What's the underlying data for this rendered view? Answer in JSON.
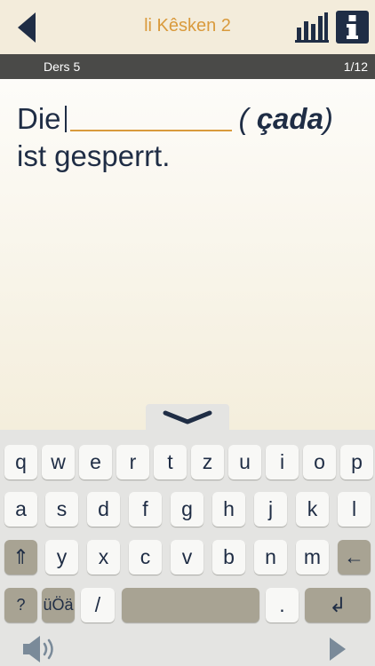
{
  "header": {
    "title": "li Kêsken 2"
  },
  "lesson": {
    "name": "Ders 5",
    "progress": "1/12"
  },
  "exercise": {
    "before": "Die",
    "hint": "çada",
    "after": "ist gesperrt."
  },
  "keyboard": {
    "row1": [
      "q",
      "w",
      "e",
      "r",
      "t",
      "z",
      "u",
      "i",
      "o",
      "p"
    ],
    "row2": [
      "a",
      "s",
      "d",
      "f",
      "g",
      "h",
      "j",
      "k",
      "l"
    ],
    "row3": [
      "y",
      "x",
      "c",
      "v",
      "b",
      "n",
      "m"
    ],
    "shift_label": "⇑",
    "backspace_label": "←",
    "numbers_label": "?123",
    "umlauts_label": "üÖä",
    "slash_label": "/",
    "period_label": ".",
    "return_label": "↲"
  },
  "colors": {
    "accent": "#d99a3c",
    "navy": "#1f2d45",
    "lesson_bar": "#4a4a48",
    "dark_key": "#a8a393"
  }
}
